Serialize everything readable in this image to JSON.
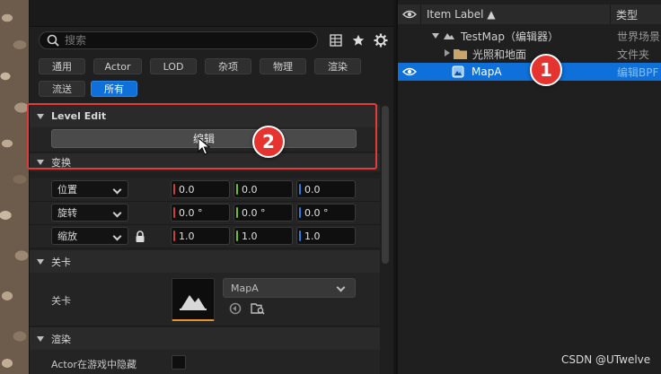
{
  "details": {
    "search": {
      "placeholder": "搜索"
    },
    "filters": [
      "通用",
      "Actor",
      "LOD",
      "杂项",
      "物理",
      "渲染",
      "流送",
      "所有"
    ],
    "active_filter": "所有",
    "sections": {
      "level_edit": {
        "title": "Level Edit",
        "edit_button": "编辑"
      },
      "transform": {
        "title": "变换",
        "rows": [
          {
            "mode": "位置",
            "x": "0.0",
            "y": "0.0",
            "z": "0.0"
          },
          {
            "mode": "旋转",
            "x": "0.0 °",
            "y": "0.0 °",
            "z": "0.0 °"
          },
          {
            "mode": "缩放",
            "x": "1.0",
            "y": "1.0",
            "z": "1.0"
          }
        ]
      },
      "level": {
        "title": "关卡",
        "label": "关卡",
        "asset": "MapA"
      },
      "rendering": {
        "title": "渲染",
        "hidden_in_game_label": "Actor在游戏中隐藏"
      }
    },
    "colors": {
      "x": "#d03b3b",
      "y": "#6fbf2a",
      "z": "#2f7bdc",
      "accent": "#0e70d8"
    }
  },
  "outliner": {
    "columns": {
      "label": "Item Label ▲",
      "type": "类型"
    },
    "rows": [
      {
        "label": "TestMap（编辑器）",
        "type": "世界场景",
        "icon": "map-icon"
      },
      {
        "label": "光照和地面",
        "type": "文件夹",
        "icon": "folder-icon"
      },
      {
        "label": "MapA",
        "type": "编辑BPF",
        "icon": "blueprint-icon",
        "selected": true
      }
    ]
  },
  "annotations": {
    "badge1": "1",
    "badge2": "2"
  },
  "watermark": "CSDN @UTwelve"
}
